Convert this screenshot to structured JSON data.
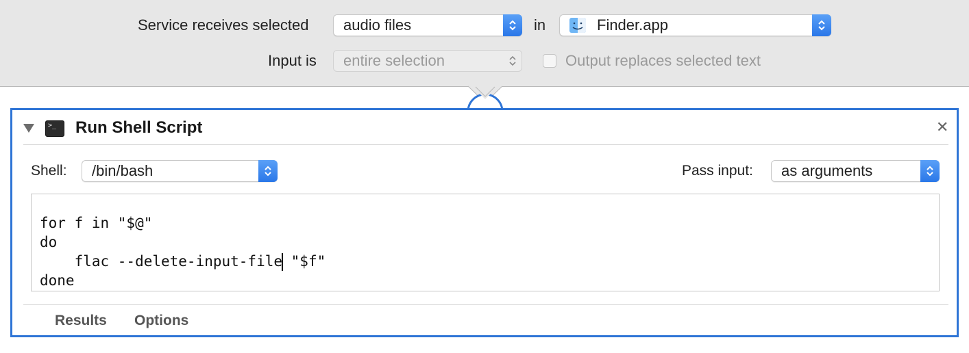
{
  "service": {
    "receives_label": "Service receives selected",
    "receives_value": "audio files",
    "in_label": "in",
    "app_value": "Finder.app",
    "input_is_label": "Input is",
    "input_is_value": "entire selection",
    "output_replaces_label": "Output replaces selected text",
    "output_replaces_checked": false
  },
  "action": {
    "title": "Run Shell Script",
    "shell_label": "Shell:",
    "shell_value": "/bin/bash",
    "pass_input_label": "Pass input:",
    "pass_input_value": "as arguments",
    "script_lines": [
      "for f in \"$@\"",
      "do",
      "    flac --delete-input-file",
      " \"$f\"",
      "done"
    ],
    "tabs": [
      "Results",
      "Options"
    ]
  },
  "colors": {
    "accent_blue": "#2f75d6",
    "panel_gray": "#e7e7e7"
  },
  "icons": {
    "popup_stepper": "updown-chevron-icon",
    "app_icon": "finder-icon",
    "action_icon": "terminal-icon",
    "collapse": "disclosure-triangle-icon",
    "close": "close-icon"
  }
}
